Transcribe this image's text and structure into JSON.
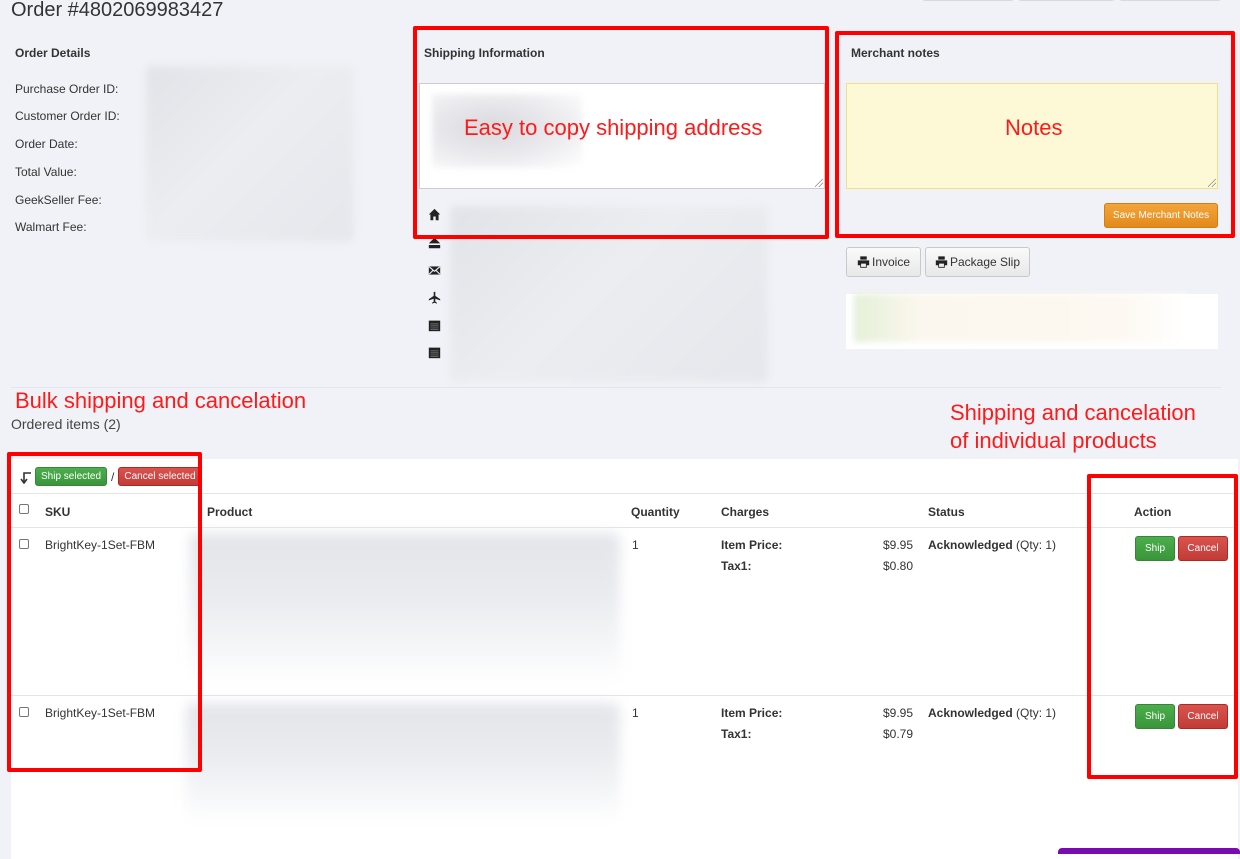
{
  "header": {
    "order_title": "Order #4802069983427"
  },
  "order_details": {
    "title": "Order Details",
    "fields": [
      {
        "label": "Purchase Order ID:"
      },
      {
        "label": "Customer Order ID:"
      },
      {
        "label": "Order Date:"
      },
      {
        "label": "Total Value:"
      },
      {
        "label": "GeekSeller Fee:"
      },
      {
        "label": "Walmart Fee:"
      }
    ]
  },
  "shipping": {
    "title": "Shipping Information",
    "icons": [
      "home-icon",
      "eject-icon",
      "envelope-icon",
      "plane-icon",
      "calendar-icon",
      "calendar-icon"
    ]
  },
  "merchant_notes": {
    "title": "Merchant notes",
    "save_label": "Save Merchant Notes"
  },
  "print_buttons": {
    "invoice_label": "Invoice",
    "package_slip_label": "Package Slip"
  },
  "items": {
    "title": "Ordered items (2)",
    "bulk": {
      "ship_selected_label": "Ship selected",
      "separator": "/",
      "cancel_selected_label": "Cancel selected"
    },
    "columns": {
      "sku": "SKU",
      "product": "Product",
      "quantity": "Quantity",
      "charges": "Charges",
      "status": "Status",
      "action": "Action"
    },
    "rows": [
      {
        "sku": "BrightKey-1Set-FBM",
        "quantity": "1",
        "charges": [
          {
            "label": "Item Price:",
            "value": "$9.95"
          },
          {
            "label": "Tax1:",
            "value": "$0.80"
          }
        ],
        "status": "Acknowledged",
        "status_qty": "(Qty: 1)",
        "ship_label": "Ship",
        "cancel_label": "Cancel"
      },
      {
        "sku": "BrightKey-1Set-FBM",
        "quantity": "1",
        "charges": [
          {
            "label": "Item Price:",
            "value": "$9.95"
          },
          {
            "label": "Tax1:",
            "value": "$0.79"
          }
        ],
        "status": "Acknowledged",
        "status_qty": "(Qty: 1)",
        "ship_label": "Ship",
        "cancel_label": "Cancel"
      }
    ]
  },
  "annotations": {
    "shipping": "Easy to copy shipping address",
    "notes": "Notes",
    "bulk": "Bulk shipping and cancelation",
    "individual_line1": "Shipping and cancelation",
    "individual_line2": "of individual products"
  },
  "colors": {
    "annotation_red": "#ff0000",
    "ship_green": "#449d44",
    "cancel_red": "#d9534f",
    "save_orange": "#ec971f",
    "notes_yellow": "#fdf9d6"
  }
}
